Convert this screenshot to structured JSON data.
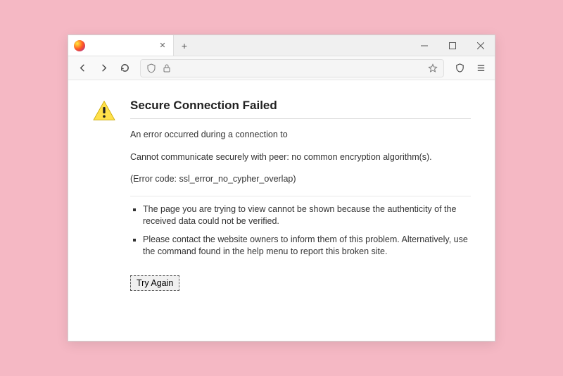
{
  "tab": {
    "title": ""
  },
  "error": {
    "heading": "Secure Connection Failed",
    "line1": "An error occurred during a connection to",
    "line2": "Cannot communicate securely with peer: no common encryption algorithm(s).",
    "code_line": "(Error code: ssl_error_no_cypher_overlap)",
    "bullets": [
      "The page you are trying to view cannot be shown because the authenticity of the received data could not be verified.",
      "Please contact the website owners to inform them of this problem. Alternatively, use the command found in the help menu to report this broken site."
    ],
    "try_again": "Try Again"
  }
}
